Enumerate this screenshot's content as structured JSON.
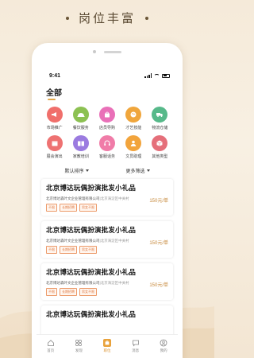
{
  "promo": {
    "title": "岗位丰富"
  },
  "status": {
    "time": "9:41"
  },
  "page": {
    "title": "全部"
  },
  "categories": [
    {
      "label": "市场推广",
      "icon": "megaphone-icon",
      "color": "#f06f6b"
    },
    {
      "label": "餐饮服务",
      "icon": "food-cover-icon",
      "color": "#8cc152"
    },
    {
      "label": "店员导购",
      "icon": "shopping-bag-icon",
      "color": "#e970b8"
    },
    {
      "label": "才艺技能",
      "icon": "palette-icon",
      "color": "#f0a63c"
    },
    {
      "label": "物流仓储",
      "icon": "truck-icon",
      "color": "#57b98a"
    },
    {
      "label": "展会演出",
      "icon": "calendar-icon",
      "color": "#ee7272"
    },
    {
      "label": "家教培训",
      "icon": "book-icon",
      "color": "#9b7be0"
    },
    {
      "label": "客服话务",
      "icon": "headset-icon",
      "color": "#f07ca8"
    },
    {
      "label": "文员助理",
      "icon": "person-icon",
      "color": "#f2a43c"
    },
    {
      "label": "其他类型",
      "icon": "box-icon",
      "color": "#e56f7a"
    }
  ],
  "filters": {
    "sort": "默认排序",
    "more": "更多筛选"
  },
  "jobs": [
    {
      "title": "北京博达玩偶扮演批发小礼品",
      "company": "北京博达森叶文企业管理有限公司",
      "address": "|北京海淀区中关村",
      "price": "150元/单",
      "tags": [
        "不限",
        "长期招聘",
        "男女不限"
      ]
    },
    {
      "title": "北京博达玩偶扮演批发小礼品",
      "company": "北京博达森叶文企业管理有限公司",
      "address": "|北京海淀区中关村",
      "price": "150元/单",
      "tags": [
        "不限",
        "长期招聘",
        "男女不限"
      ]
    },
    {
      "title": "北京博达玩偶扮演批发小礼品",
      "company": "北京博达森叶文企业管理有限公司",
      "address": "|北京海淀区中关村",
      "price": "150元/单",
      "tags": [
        "不限",
        "长期招聘",
        "男女不限"
      ]
    },
    {
      "title": "北京博达玩偶扮演批发小礼品",
      "company": "",
      "address": "",
      "price": "",
      "tags": []
    }
  ],
  "tabs": [
    {
      "label": "首页",
      "icon": "home-icon",
      "active": false
    },
    {
      "label": "发现",
      "icon": "discover-icon",
      "active": false
    },
    {
      "label": "职位",
      "icon": "jobs-icon",
      "active": true
    },
    {
      "label": "消息",
      "icon": "message-icon",
      "active": false
    },
    {
      "label": "我的",
      "icon": "profile-icon",
      "active": false
    }
  ],
  "colors": {
    "accent": "#e9a23b",
    "price": "#c6883a",
    "tag": "#e07a44"
  }
}
